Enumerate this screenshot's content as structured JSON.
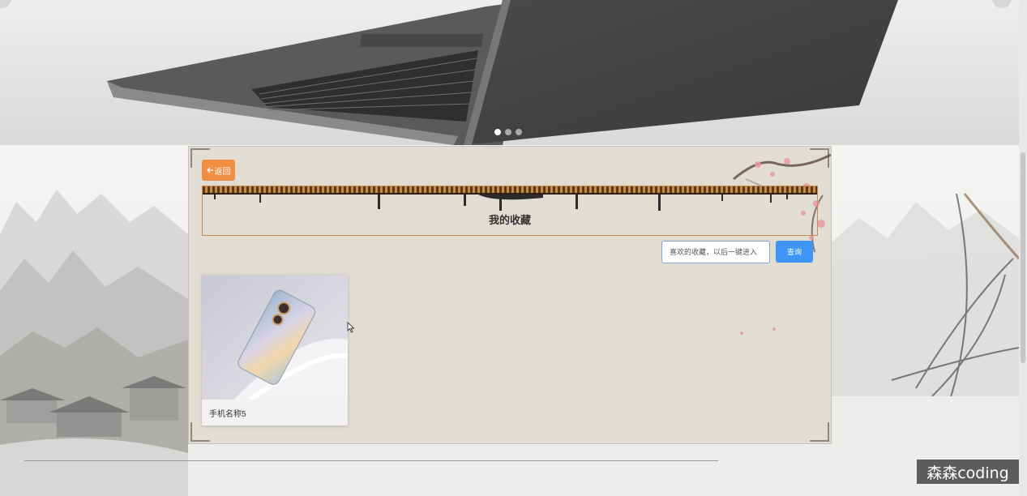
{
  "carousel": {
    "slide_count": 3,
    "active_index": 0
  },
  "panel": {
    "back_label": "返回",
    "title": "我的收藏",
    "search": {
      "placeholder": "喜欢的收藏，以后一键进入",
      "button_label": "查询"
    },
    "favorites": [
      {
        "name": "手机名称5"
      }
    ]
  },
  "watermark": "森森coding",
  "colors": {
    "back_button": "#f08f43",
    "search_button": "#3e95f5",
    "panel_bg": "#e1ddd3",
    "title_border": "#c78a4e"
  },
  "icons": {
    "back": "arrow-left-icon",
    "cursor": "mouse-pointer-icon"
  }
}
